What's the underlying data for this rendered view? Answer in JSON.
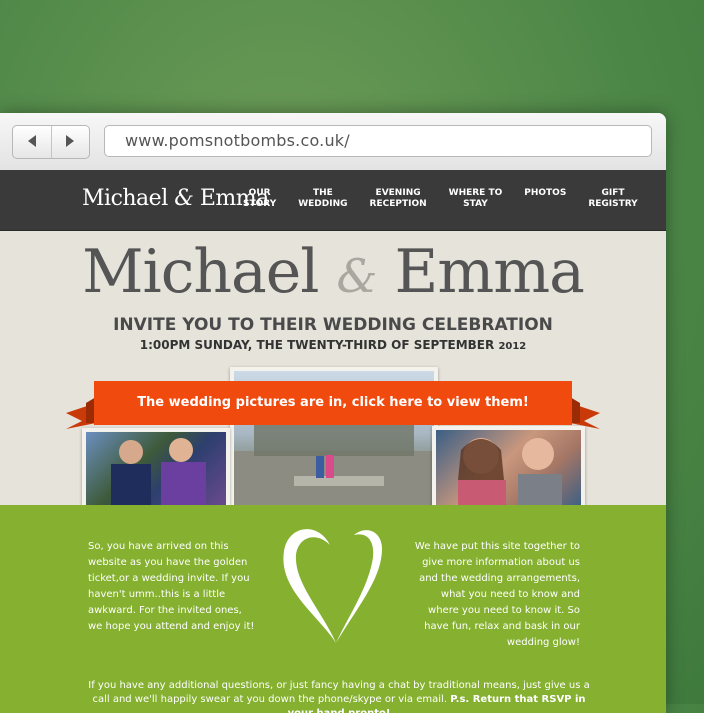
{
  "browser": {
    "back_icon": "chevron-left-icon",
    "forward_icon": "chevron-right-icon",
    "url": "www.pomsnotbombs.co.uk/"
  },
  "site": {
    "logo_first": "Michael",
    "logo_amp": "&",
    "logo_second": "Emma",
    "menu": [
      {
        "line1": "OUR",
        "line2": "STORY"
      },
      {
        "line1": "THE",
        "line2": "WEDDING"
      },
      {
        "line1": "EVENING",
        "line2": "RECEPTION"
      },
      {
        "line1": "WHERE TO",
        "line2": "STAY"
      },
      {
        "line1": "PHOTOS",
        "line2": ""
      },
      {
        "line1": "GIFT",
        "line2": "REGISTRY"
      }
    ]
  },
  "hero": {
    "title_first": "Michael",
    "title_amp": "&",
    "title_second": "Emma",
    "invite": "INVITE YOU TO THEIR WEDDING CELEBRATION",
    "date_time": "1:00",
    "date_rest": "PM SUNDAY, THE TWENTY-THIRD OF SEPTEMBER ",
    "date_year": "2012",
    "banner_text": "The wedding pictures are in, click here to view them!",
    "banner_color": "#f04a0e"
  },
  "intro": {
    "left": "So, you have arrived on this website as you have the golden ticket,or a wedding invite. If you haven't umm..this is a little awkward. For the invited ones, we hope you attend and enjoy it!",
    "right": "We have put this site together to give more information about us and the wedding arrangements, what you need to know and where you need to know it. So have fun, relax and bask in our wedding glow!",
    "bottom": "If you have any additional questions, or just fancy having a chat by traditional means, just give us a call and we'll happily swear at you down the phone/skype or via email. ",
    "bottom_bold": "P.s. Return that RSVP in your hand pronto!",
    "green_color": "#85b030"
  }
}
